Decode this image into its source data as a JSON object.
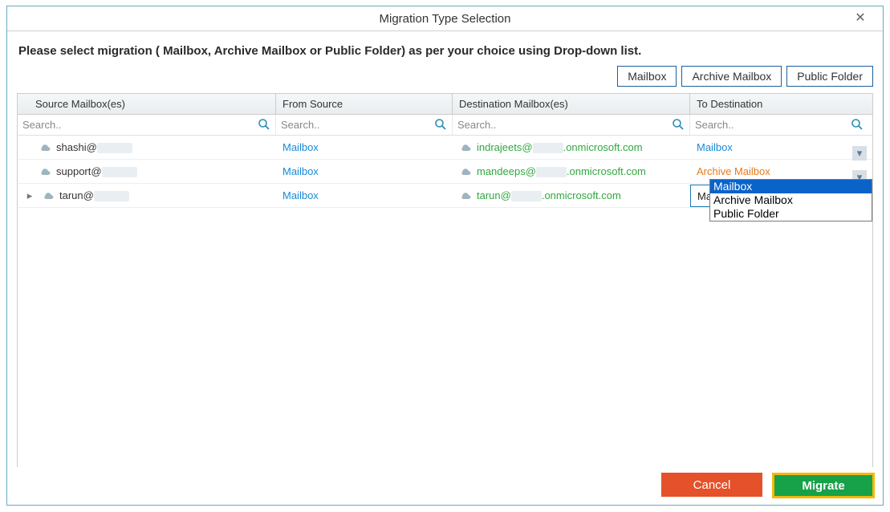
{
  "dialog": {
    "title": "Migration Type Selection",
    "close_glyph": "✕",
    "instruction": "Please select migration ( Mailbox, Archive Mailbox or Public Folder) as per your choice using Drop-down list."
  },
  "top_buttons": {
    "mailbox": "Mailbox",
    "archive": "Archive Mailbox",
    "public": "Public Folder"
  },
  "columns": {
    "source": "Source Mailbox(es)",
    "from": "From Source",
    "dest": "Destination Mailbox(es)",
    "to": "To Destination"
  },
  "search_placeholder": "Search..",
  "rows": [
    {
      "source": "shashi@",
      "from": "Mailbox",
      "dest_prefix": "indrajeets@",
      "dest_suffix": ".onmicrosoft.com",
      "to": "Mailbox",
      "to_color": "link-blue",
      "expandable": false
    },
    {
      "source": "support@",
      "from": "Mailbox",
      "dest_prefix": "mandeeps@",
      "dest_suffix": ".onmicrosoft.com",
      "to": "Archive Mailbox",
      "to_color": "link-orange",
      "expandable": false
    },
    {
      "source": "tarun@",
      "from": "Mailbox",
      "dest_prefix": "tarun@",
      "dest_suffix": ".onmicrosoft.com",
      "to": "Mailbox",
      "to_color": "",
      "expandable": true,
      "dropdown_open": true
    }
  ],
  "dropdown_options": [
    "Mailbox",
    "Archive Mailbox",
    "Public Folder"
  ],
  "dropdown_selected": "Mailbox",
  "buttons": {
    "cancel": "Cancel",
    "migrate": "Migrate"
  }
}
